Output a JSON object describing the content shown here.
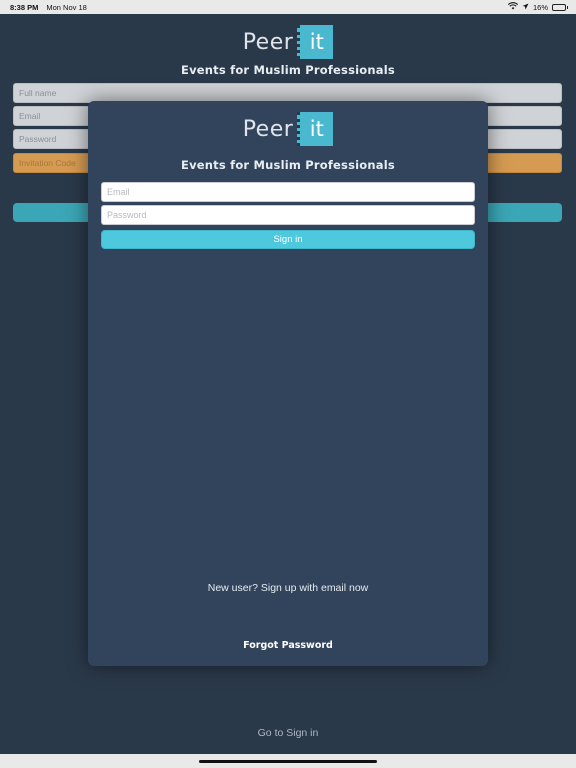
{
  "status_bar": {
    "time": "8:38 PM",
    "date": "Mon Nov 18",
    "battery": "16%",
    "battery_level": 0.16
  },
  "brand": {
    "logo_left": "Peer",
    "logo_right": "it",
    "tagline": "Events for Muslim Professionals"
  },
  "background_form": {
    "full_name_placeholder": "Full name",
    "email_placeholder": "Email",
    "password_placeholder": "Password",
    "invitation_placeholder": "Invitation Code",
    "go_to_signin": "Go to Sign in"
  },
  "signin_modal": {
    "email_placeholder": "Email",
    "password_placeholder": "Password",
    "signin_label": "Sign in",
    "new_user_link": "New user? Sign up with email now",
    "forgot_password": "Forgot Password"
  },
  "colors": {
    "background": "#2a394a",
    "modal": "#31445c",
    "accent": "#4dc8dd",
    "invite_field": "#d59b52"
  }
}
